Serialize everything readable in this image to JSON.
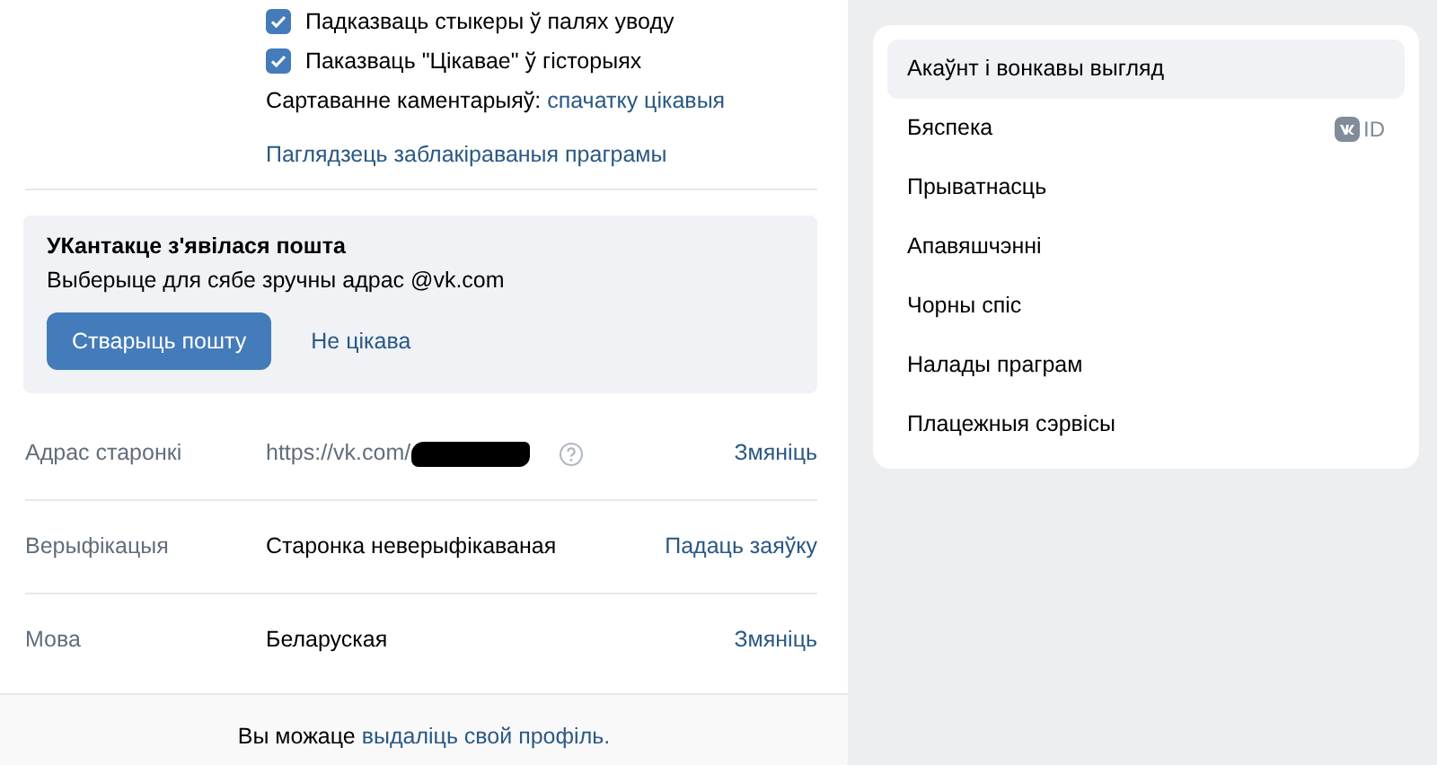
{
  "options": [
    {
      "label": "Падказваць стыкеры ў палях уводу",
      "checked": true
    },
    {
      "label": "Паказваць \"Цікавае\" ў гісторыях",
      "checked": true
    }
  ],
  "sort": {
    "label": "Сартаванне каментарыяў:",
    "value": "спачатку цікавыя"
  },
  "blocked_apps_link": "Паглядзець заблакіраваныя праграмы",
  "mail_banner": {
    "title": "УКантакце з'явілася пошта",
    "text": "Выберыце для сябе зручны адрас @vk.com",
    "primary": "Стварыць пошту",
    "secondary": "Не цікава"
  },
  "rows": [
    {
      "kind": "url",
      "label": "Адрас старонкі",
      "value": "https://vk.com/",
      "redacted": true,
      "action": "Змяніць"
    },
    {
      "kind": "text",
      "label": "Верыфікацыя",
      "value": "Старонка неверыфікаваная",
      "action": "Падаць заяўку"
    },
    {
      "kind": "text",
      "label": "Мова",
      "value": "Беларуская",
      "action": "Змяніць"
    }
  ],
  "footer": {
    "text": "Вы можаце",
    "link": "выдаліць свой профіль."
  },
  "menu": [
    {
      "label": "Акаўнт і вонкавы выгляд",
      "selected": true
    },
    {
      "label": "Бяспека",
      "selected": false,
      "badge": "ID"
    },
    {
      "label": "Прыватнасць",
      "selected": false
    },
    {
      "label": "Апавяшчэнні",
      "selected": false
    },
    {
      "label": "Чорны спіс",
      "selected": false
    },
    {
      "label": "Налады праграм",
      "selected": false
    },
    {
      "label": "Плацежныя сэрвісы",
      "selected": false
    }
  ]
}
